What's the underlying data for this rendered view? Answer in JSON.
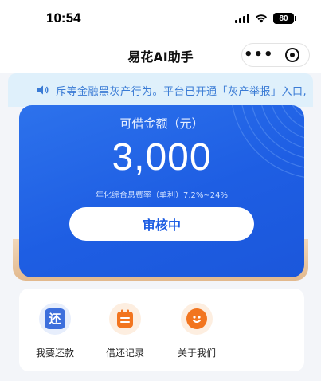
{
  "status_bar": {
    "time": "10:54",
    "battery": "80",
    "icons": [
      "signal-icon",
      "wifi-icon",
      "battery-icon"
    ]
  },
  "nav": {
    "title": "易花AI助手",
    "more_label": "•••",
    "icons": [
      "more-icon",
      "target-icon"
    ]
  },
  "notice": {
    "text": "斥等金融黑灰产行为。平台已开通「灰产举报」入口,",
    "icon": "speaker-icon"
  },
  "loan_card": {
    "label": "可借金额（元）",
    "amount": "3,000",
    "rate_text": "年化综合息费率（单利）7.2%~24%",
    "button_label": "审核中"
  },
  "services": [
    {
      "label": "我要还款",
      "icon": "repay-icon",
      "glyph": "还"
    },
    {
      "label": "借还记录",
      "icon": "record-icon"
    },
    {
      "label": "关于我们",
      "icon": "smile-icon"
    }
  ],
  "colors": {
    "brand_blue": "#1e5ee3",
    "notice_bg": "#dff0fb",
    "notice_text": "#3a7bd5",
    "accent_orange": "#f2751f"
  }
}
